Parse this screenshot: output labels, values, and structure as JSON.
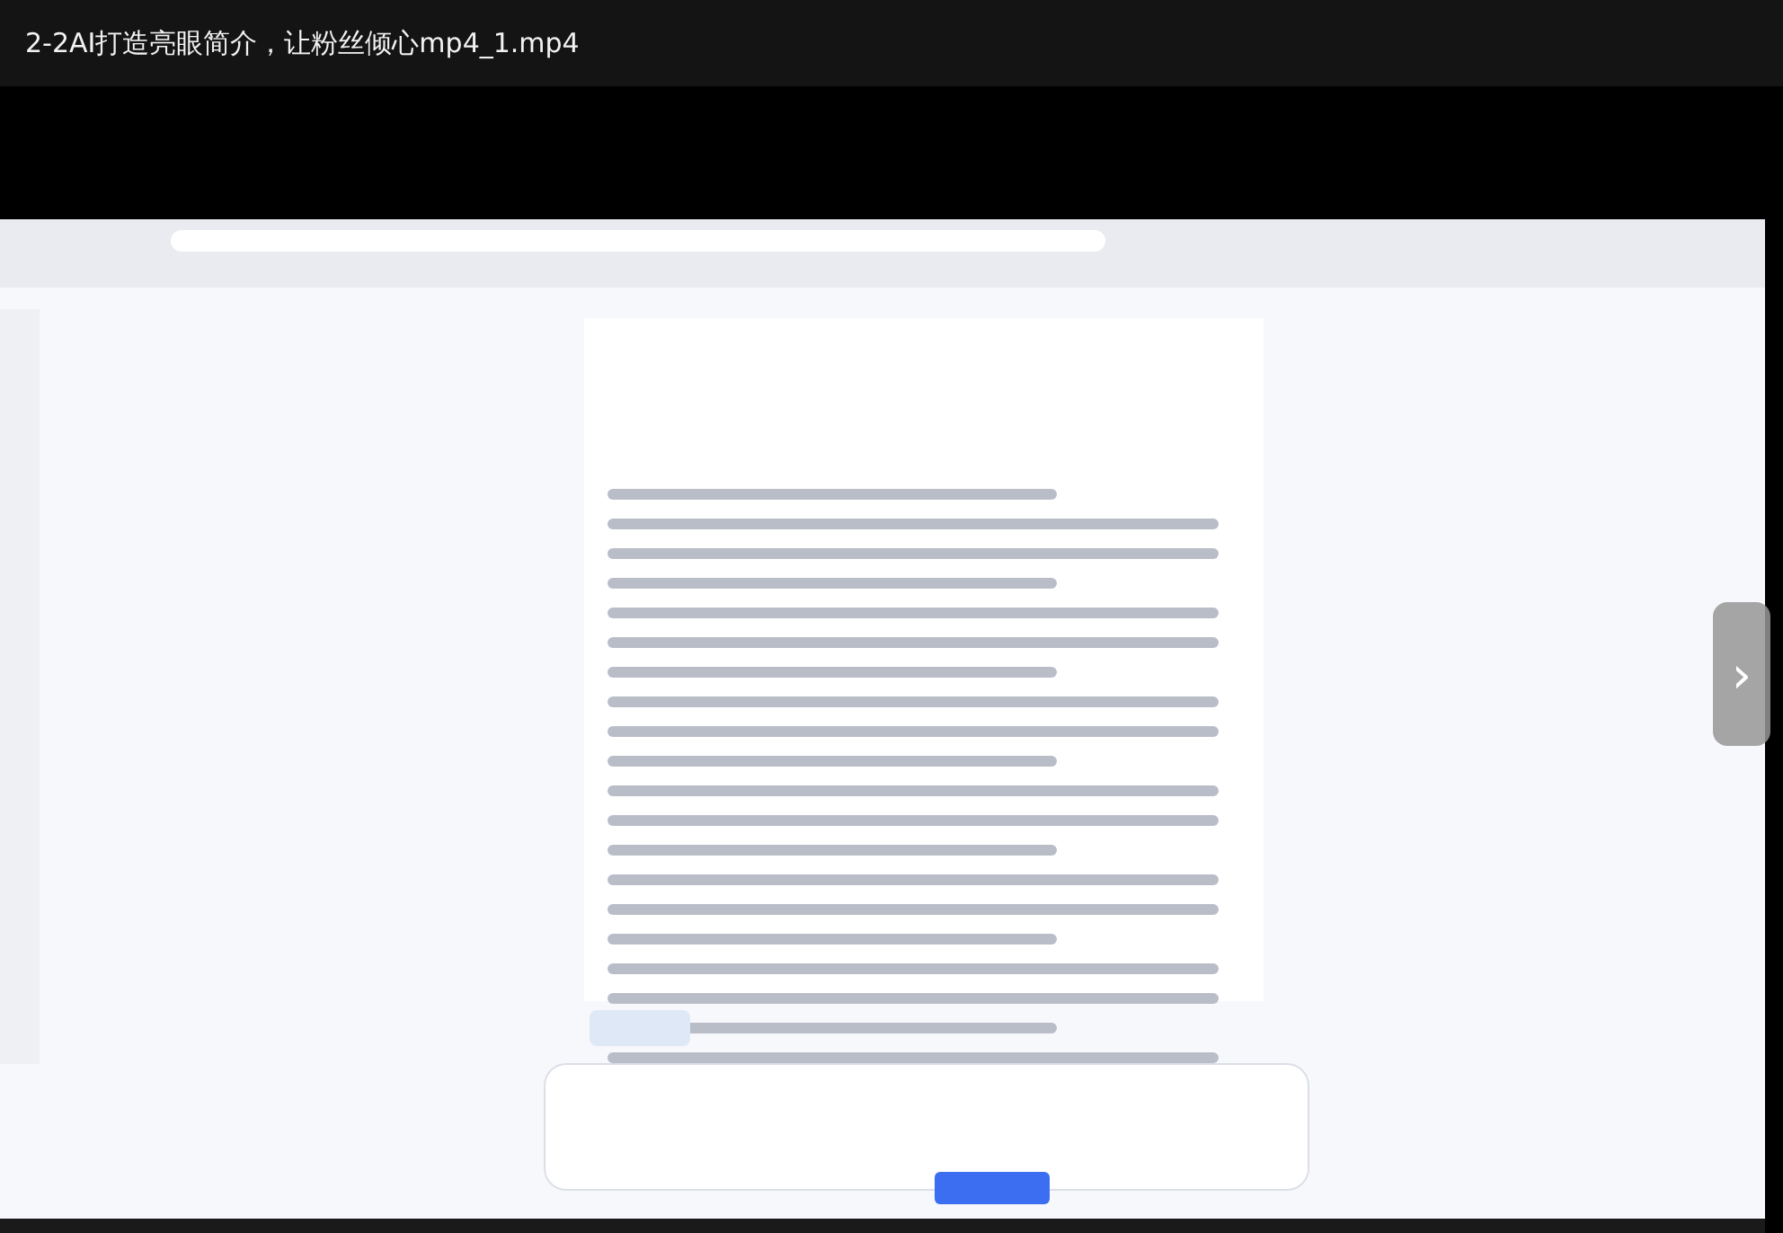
{
  "window": {
    "title": "2-2AI打造亮眼简介，让粉丝倾心mp4_1.mp4"
  },
  "next_button": {
    "label": "›"
  }
}
